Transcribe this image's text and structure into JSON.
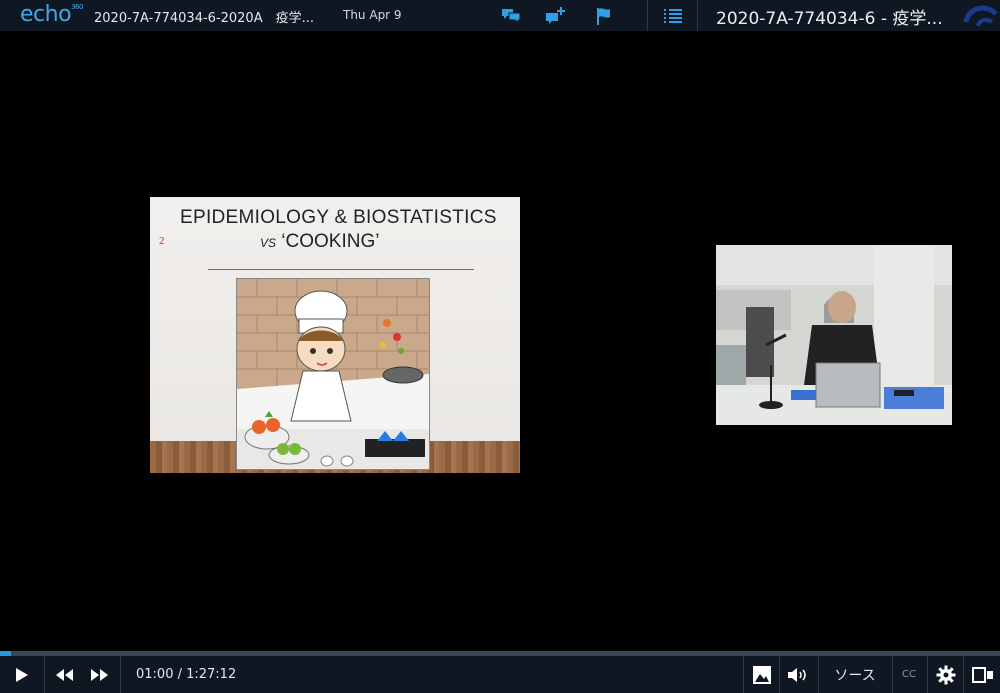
{
  "header": {
    "logo_text": "echo",
    "logo_sup": "360",
    "course_title": "2020-7A-774034-6-2020A　疫学...",
    "date": "Thu Apr 9",
    "session_title": "2020-7A-774034-6 - 疫学...",
    "icons": [
      "discussion-icon",
      "add-note-icon",
      "flag-icon",
      "outline-list-icon"
    ],
    "accent_color": "#2f9fe6"
  },
  "slide": {
    "title_line1": "EPIDEMIOLOGY & BIOSTATISTICS",
    "title_vs": "VS",
    "title_line2": "‘COOKING’",
    "slide_number": "2"
  },
  "player": {
    "time_display": "01:00 / 1:27:12",
    "progress_fraction": 0.011,
    "source_label": "ソース",
    "cc_label": "CC",
    "progress_color": "#1e9be0"
  }
}
